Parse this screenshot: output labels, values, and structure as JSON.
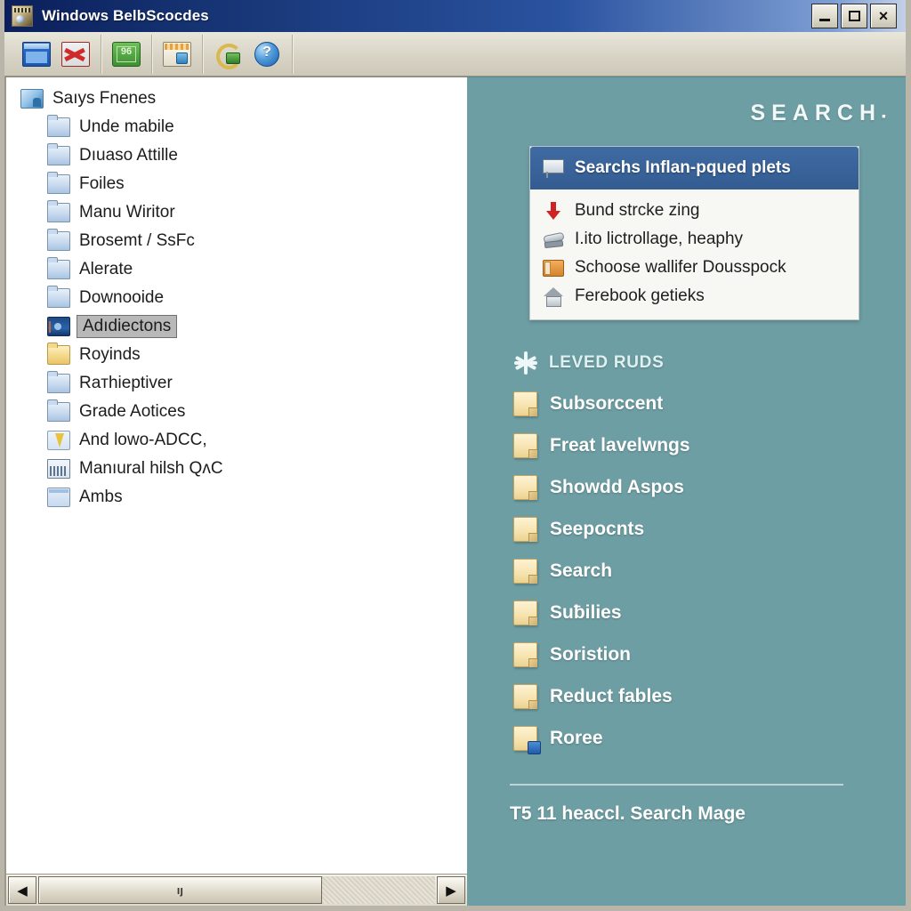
{
  "window": {
    "title": "Windows BelbScocdes",
    "icon": "app-icon",
    "controls": {
      "minimize": "_",
      "maximize": "□",
      "close": "×"
    }
  },
  "toolbar": {
    "groups": [
      {
        "buttons": [
          {
            "name": "window-icon",
            "label": ""
          },
          {
            "name": "red-x-icon",
            "label": ""
          }
        ]
      },
      {
        "buttons": [
          {
            "name": "money-icon",
            "label": ""
          }
        ]
      },
      {
        "buttons": [
          {
            "name": "cards-icon",
            "label": ""
          }
        ]
      },
      {
        "buttons": [
          {
            "name": "refresh-money-icon",
            "label": ""
          },
          {
            "name": "help-icon",
            "label": ""
          }
        ]
      }
    ]
  },
  "tree": {
    "root": {
      "label": "Saıys Fnenes",
      "icon": "computer-icon"
    },
    "items": [
      {
        "label": "Unde mabile",
        "icon": "folder-icon",
        "selected": false
      },
      {
        "label": "Dıuaso Attille",
        "icon": "folder-icon",
        "selected": false
      },
      {
        "label": "Foiles",
        "icon": "folder-icon",
        "selected": false
      },
      {
        "label": "Manu Wiritor",
        "icon": "folder-icon",
        "selected": false
      },
      {
        "label": "Brosemt / SsFc",
        "icon": "folder-icon",
        "selected": false
      },
      {
        "label": "Alerate",
        "icon": "folder-icon",
        "selected": false
      },
      {
        "label": "Downooide",
        "icon": "folder-icon",
        "selected": false
      },
      {
        "label": "Adıdiectons",
        "icon": "monitor-icon",
        "selected": true
      },
      {
        "label": "Royinds",
        "icon": "folder-yellow-icon",
        "selected": false
      },
      {
        "label": "Raᴛhieptiver",
        "icon": "folder-icon",
        "selected": false
      },
      {
        "label": "Grade Aotices",
        "icon": "folder-icon",
        "selected": false
      },
      {
        "label": "And lowo-ADCC,",
        "icon": "lightning-folder-icon",
        "selected": false
      },
      {
        "label": "Manıural hilsh QʌC",
        "icon": "grid-icon",
        "selected": false
      },
      {
        "label": "Ambs",
        "icon": "window-icon",
        "selected": false
      }
    ]
  },
  "hscrollbar": {
    "left_arrow": "◀",
    "right_arrow": "▶",
    "thumb_label": "ıȷ"
  },
  "right_panel": {
    "brand": "SEARCH",
    "brand_dot": "▪",
    "dropdown": {
      "header": {
        "label": "Searchs Inflan-pqued plets",
        "icon": "sign-icon"
      },
      "items": [
        {
          "label": "Bund strcke zing",
          "icon": "arrow-down-icon"
        },
        {
          "label": "I.ito lictrollage, heaphy",
          "icon": "stapler-icon"
        },
        {
          "label": "Schoose wallifer Dousspock",
          "icon": "wallet-icon"
        },
        {
          "label": "Ferebook getieks",
          "icon": "house-icon"
        }
      ]
    },
    "section": {
      "icon": "star-icon",
      "title": "LEVED RUDS",
      "folders": [
        {
          "label": "Subsorccent",
          "icon": "folder-icon",
          "badge": false
        },
        {
          "label": "Freat lavelwngs",
          "icon": "folder-icon",
          "badge": false
        },
        {
          "label": "Showdd Aspos",
          "icon": "folder-icon",
          "badge": false
        },
        {
          "label": "Seepocnts",
          "icon": "folder-icon",
          "badge": false
        },
        {
          "label": "Search",
          "icon": "folder-icon",
          "badge": false
        },
        {
          "label": "Suƀilies",
          "icon": "folder-icon",
          "badge": false
        },
        {
          "label": "Soristion",
          "icon": "folder-icon",
          "badge": false
        },
        {
          "label": "Reduct fables",
          "icon": "folder-icon",
          "badge": false
        },
        {
          "label": "Roree",
          "icon": "folder-badge-icon",
          "badge": true
        }
      ]
    },
    "footer": "T5 11 heaccl. Search Mage"
  },
  "colors": {
    "title_bar_start": "#0b1f5c",
    "title_bar_end": "#c3d0e6",
    "panel_teal": "#6d9ea3",
    "dropdown_header_blue": "#3f6ba3",
    "toolbar_bg": "#d9d5c7",
    "tree_bg": "#ffffff",
    "selection_grey": "#b8b8b8"
  }
}
